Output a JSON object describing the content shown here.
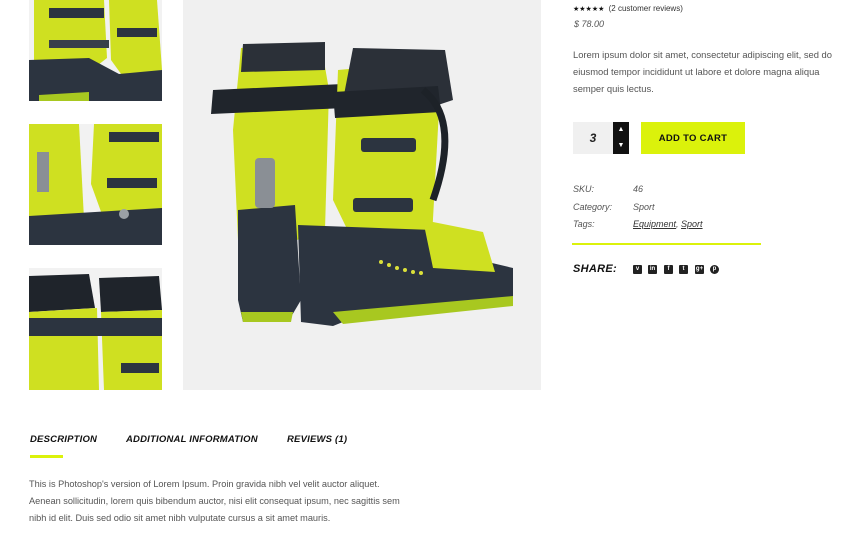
{
  "product": {
    "rating_stars": "★★★★★",
    "review_count_text": "(2 customer reviews)",
    "price": "$ 78.00",
    "excerpt": "Lorem ipsum dolor sit amet, consectetur adipiscing elit, sed do eiusmod tempor incididunt ut labore et dolore magna aliqua semper quis lectus.",
    "quantity": "3",
    "add_to_cart_label": "ADD TO CART"
  },
  "meta": {
    "sku_label": "SKU:",
    "sku_value": "46",
    "category_label": "Category:",
    "category_value": "Sport",
    "tags_label": "Tags:",
    "tags": [
      "Equipment",
      "Sport"
    ],
    "tag_separator": ", "
  },
  "share": {
    "label": "SHARE:",
    "icons": [
      "vimeo-icon",
      "linkedin-icon",
      "facebook-icon",
      "twitter-icon",
      "google-plus-icon",
      "pinterest-icon"
    ]
  },
  "tabs": [
    {
      "label": "DESCRIPTION"
    },
    {
      "label": "ADDITIONAL INFORMATION"
    },
    {
      "label": "REVIEWS (1)"
    }
  ],
  "description_text": "This is Photoshop's version  of Lorem Ipsum. Proin gravida nibh vel velit auctor aliquet. Aenean sollicitudin, lorem quis bibendum auctor, nisi elit consequat ipsum, nec sagittis sem nibh id elit. Duis sed odio sit amet nibh vulputate cursus a sit amet mauris.",
  "colors": {
    "accent": "#dbf20b",
    "boot_yellow": "#cfe021",
    "boot_dark": "#2c3440",
    "image_background": "#f0f0f0"
  }
}
